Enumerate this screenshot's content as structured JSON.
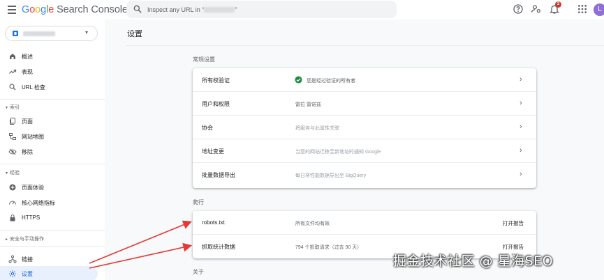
{
  "header": {
    "logo_google": "Google",
    "logo_product": " Search Console",
    "search_placeholder": "Inspect any URL in “",
    "search_suffix": "”",
    "notification_count": "2",
    "avatar_initial": "L"
  },
  "sidebar": {
    "items": [
      {
        "label": "概述"
      },
      {
        "label": "表现"
      },
      {
        "label": "URL 检查"
      }
    ],
    "section_index": "索引",
    "index_items": [
      {
        "label": "页面"
      },
      {
        "label": "网站地图"
      },
      {
        "label": "移除"
      }
    ],
    "section_experience": "经验",
    "experience_items": [
      {
        "label": "页面体验"
      },
      {
        "label": "核心网络指标"
      },
      {
        "label": "HTTPS"
      }
    ],
    "section_security": "安全与手动操作",
    "bottom_items": [
      {
        "label": "链接"
      },
      {
        "label": "设置"
      }
    ]
  },
  "main": {
    "title": "设置",
    "general": {
      "heading": "常规设置",
      "rows": [
        {
          "label": "所有权验证",
          "value": "您是经过验证的所有者"
        },
        {
          "label": "用户和权限",
          "value": "雷拉 雷诺兹"
        },
        {
          "label": "协会",
          "value": "将服务与此属性关联"
        },
        {
          "label": "地址变更",
          "value": "当您的网站迁移至新地址时通知 Google"
        },
        {
          "label": "批量数据导出",
          "value": "每日将性能数据导出至 BigQuery"
        }
      ]
    },
    "crawl": {
      "heading": "爬行",
      "rows": [
        {
          "label": "robots.txt",
          "value": "所有文件均有效",
          "action": "打开报告"
        },
        {
          "label": "抓取统计数据",
          "value": "794 个抓取请求（过去 90 天）",
          "action": "打开报告"
        }
      ]
    },
    "about_heading": "关于"
  },
  "watermark": "掘金技术社区 @ 星海SEO",
  "colors": {
    "accent": "#1967d2",
    "active_bg": "#e8f0fe",
    "check": "#1e8e3e",
    "arrow": "#e53935",
    "badge": "#d93025"
  }
}
